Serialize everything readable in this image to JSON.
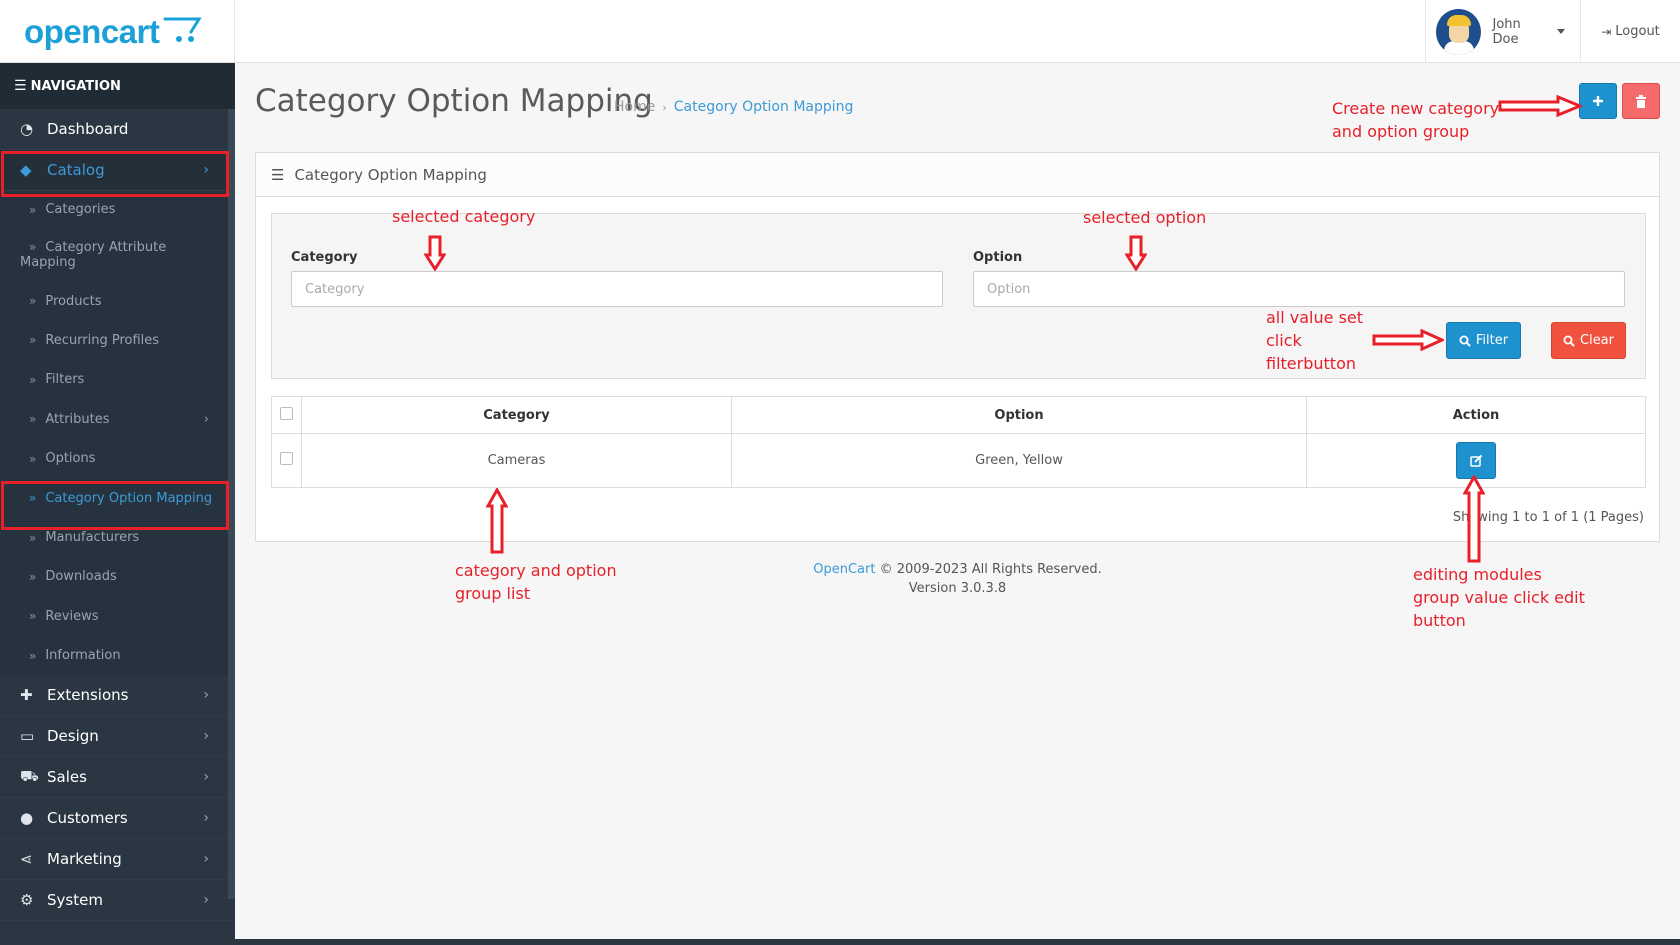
{
  "brand": {
    "logo_text": "opencart"
  },
  "header": {
    "user_name": "John Doe",
    "logout_label": "Logout"
  },
  "sidebar": {
    "nav_label": "NAVIGATION",
    "items": [
      {
        "label": "Dashboard",
        "icon": "dashboard-icon"
      },
      {
        "label": "Catalog",
        "icon": "tag-icon"
      },
      {
        "label": "Extensions",
        "icon": "puzzle-icon"
      },
      {
        "label": "Design",
        "icon": "monitor-icon"
      },
      {
        "label": "Sales",
        "icon": "cart-icon"
      },
      {
        "label": "Customers",
        "icon": "user-icon"
      },
      {
        "label": "Marketing",
        "icon": "share-icon"
      },
      {
        "label": "System",
        "icon": "cog-icon"
      }
    ],
    "catalog_sub": [
      {
        "label": "Categories"
      },
      {
        "label": "Category Attribute",
        "label2": "Mapping"
      },
      {
        "label": "Products"
      },
      {
        "label": "Recurring Profiles"
      },
      {
        "label": "Filters"
      },
      {
        "label": "Attributes"
      },
      {
        "label": "Options"
      },
      {
        "label": "Category Option Mapping"
      },
      {
        "label": "Manufacturers"
      },
      {
        "label": "Downloads"
      },
      {
        "label": "Reviews"
      },
      {
        "label": "Information"
      }
    ]
  },
  "page": {
    "title": "Category Option Mapping",
    "breadcrumb_home": "Home",
    "breadcrumb_current": "Category Option Mapping"
  },
  "panel": {
    "title": "Category Option Mapping"
  },
  "filter": {
    "category_label": "Category",
    "category_placeholder": "Category",
    "option_label": "Option",
    "option_placeholder": "Option",
    "filter_button": "Filter",
    "clear_button": "Clear"
  },
  "table": {
    "headers": [
      "Category",
      "Option",
      "Action"
    ],
    "rows": [
      {
        "category": "Cameras",
        "option": "Green, Yellow"
      }
    ]
  },
  "pagination": {
    "text": "Showing 1 to 1 of 1 (1 Pages)"
  },
  "footer": {
    "brand_link": "OpenCart",
    "copyright": "© 2009-2023 All Rights Reserved.",
    "version": "Version 3.0.3.8"
  },
  "annotations": {
    "create_line1": "Create new category",
    "create_line2": "and option group",
    "selected_category": "selected category",
    "selected_option": "selected option",
    "filter_line1": "all value set",
    "filter_line2": "click",
    "filter_line3": "filterbutton",
    "list_line1": "category and option",
    "list_line2": "group list",
    "edit_line1": "editing modules",
    "edit_line2": "group value click edit",
    "edit_line3": "button"
  },
  "colors": {
    "accent": "#1e91cf",
    "danger": "#f56b6b",
    "sidebar": "#2a3642",
    "annotation": "#e8202a"
  }
}
